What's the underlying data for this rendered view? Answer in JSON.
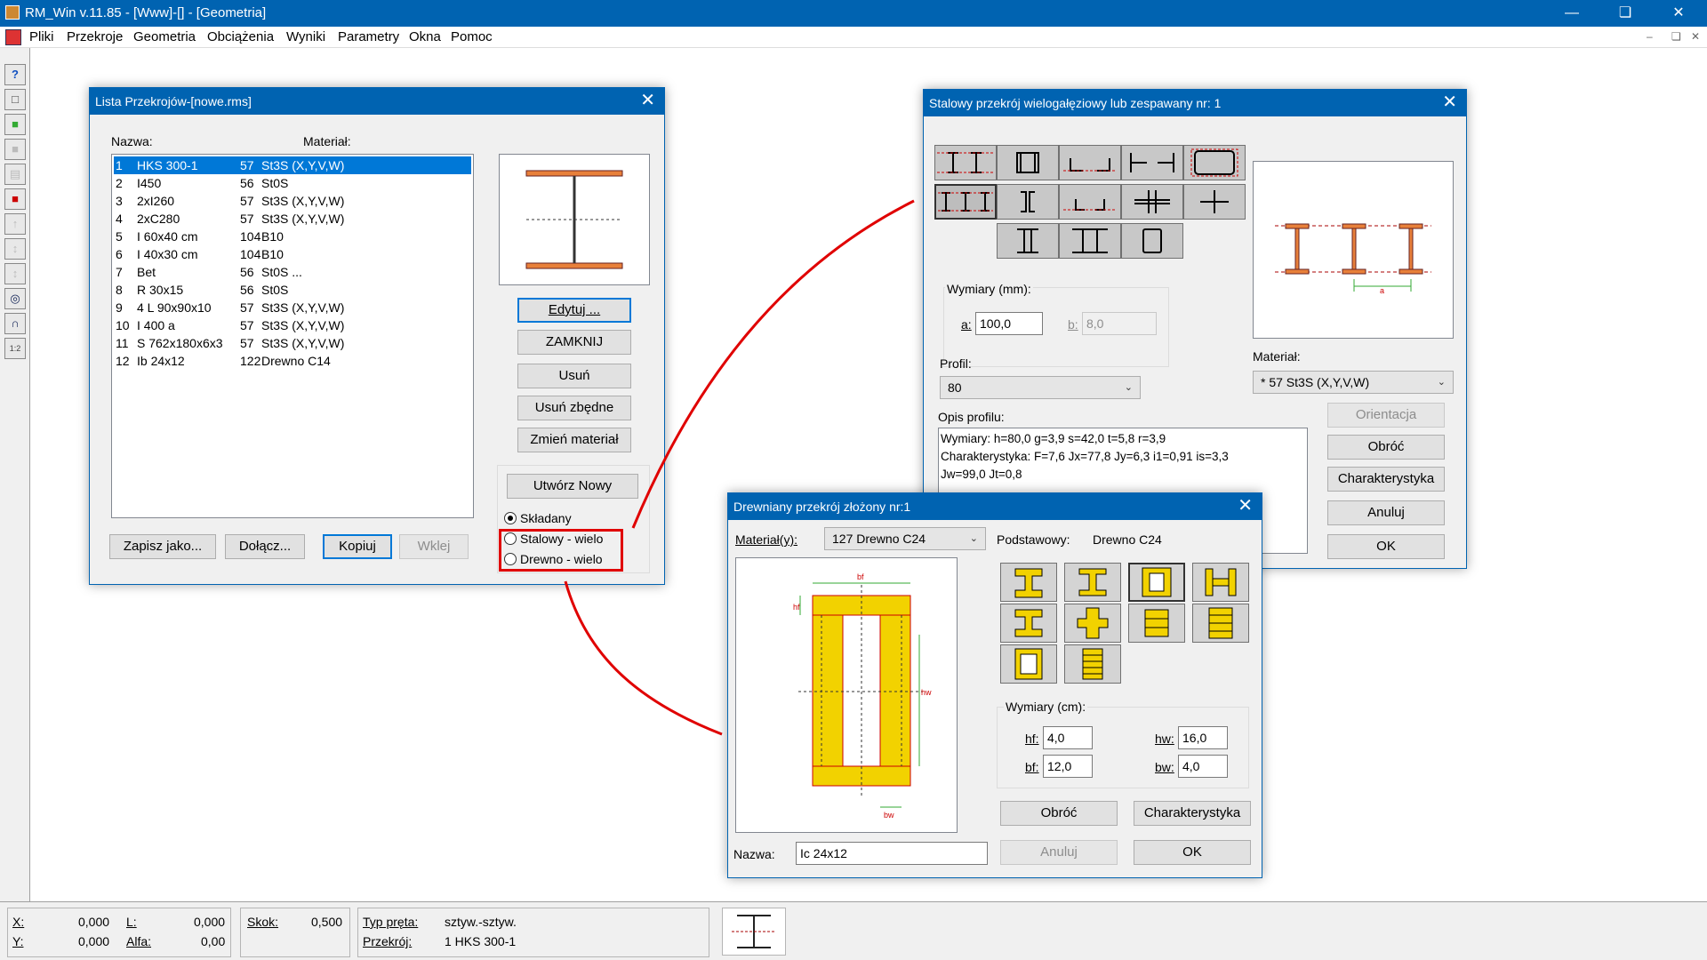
{
  "app": {
    "title": "RM_Win v.11.85 - [Www]-[] - [Geometria]"
  },
  "menu": [
    "Pliki",
    "Przekroje",
    "Geometria",
    "Obciążenia",
    "Wyniki",
    "Parametry",
    "Okna",
    "Pomoc"
  ],
  "lista": {
    "title": "Lista Przekrojów-[nowe.rms]",
    "col_name": "Nazwa:",
    "col_mat": "Materiał:",
    "rows": [
      {
        "n": "1",
        "name": "HKS 300-1",
        "code": "57",
        "mat": "St3S (X,Y,V,W)"
      },
      {
        "n": "2",
        "name": "I450",
        "code": "56",
        "mat": "St0S"
      },
      {
        "n": "3",
        "name": "2xI260",
        "code": "57",
        "mat": "St3S (X,Y,V,W)"
      },
      {
        "n": "4",
        "name": "2xC280",
        "code": "57",
        "mat": "St3S (X,Y,V,W)"
      },
      {
        "n": "5",
        "name": "I 60x40 cm",
        "code": "104",
        "mat": "B10"
      },
      {
        "n": "6",
        "name": "I 40x30 cm",
        "code": "104",
        "mat": "B10"
      },
      {
        "n": "7",
        "name": "Bet",
        "code": "56",
        "mat": "St0S ..."
      },
      {
        "n": "8",
        "name": "R 30x15",
        "code": "56",
        "mat": "St0S"
      },
      {
        "n": "9",
        "name": "4 L 90x90x10",
        "code": "57",
        "mat": "St3S (X,Y,V,W)"
      },
      {
        "n": "10",
        "name": "I 400 a",
        "code": "57",
        "mat": "St3S (X,Y,V,W)"
      },
      {
        "n": "11",
        "name": "S 762x180x6x3",
        "code": "57",
        "mat": "St3S (X,Y,V,W)"
      },
      {
        "n": "12",
        "name": "Ib 24x12",
        "code": "122",
        "mat": "Drewno C14"
      }
    ],
    "btn_edytuj": "Edytuj ...",
    "btn_zamknij": "ZAMKNIJ",
    "btn_usun": "Usuń",
    "btn_usun_zbedne": "Usuń zbędne",
    "btn_zmien": "Zmień materiał",
    "btn_utworz": "Utwórz Nowy",
    "radio_skladany": "Składany",
    "radio_stalowy": "Stalowy - wielo",
    "radio_drewno": "Drewno - wielo",
    "btn_zapisz": "Zapisz jako...",
    "btn_dolacz": "Dołącz...",
    "btn_kopiuj": "Kopiuj",
    "btn_wklej": "Wklej"
  },
  "stalowy": {
    "title": "Stalowy przekrój wielogałęziowy lub zespawany nr: 1",
    "wymiary": "Wymiary (mm):",
    "a_lbl": "a:",
    "a_val": "100,0",
    "b_lbl": "b:",
    "b_val": "8,0",
    "profil_lbl": "Profil:",
    "profil_val": "80",
    "material_lbl": "Materiał:",
    "material_val": "* 57  St3S (X,Y,V,W)",
    "opis_lbl": "Opis profilu:",
    "opis1": "Wymiary: h=80,0  g=3,9  s=42,0  t=5,8  r=3,9",
    "opis2": "Charakterystyka:     F=7,6  Jx=77,8  Jy=6,3  i1=0,91  is=3,3",
    "opis3": "Jw=99,0  Jt=0,8",
    "btn_orient": "Orientacja",
    "btn_obroc": "Obróć",
    "btn_char": "Charakterystyka",
    "btn_anuluj": "Anuluj",
    "btn_ok": "OK",
    "dim_a": "a"
  },
  "drewno": {
    "title": "Drewniany przekrój złożony nr:1",
    "material_lbl": "Materiał(y):",
    "material_val": "127  Drewno C24",
    "podst_lbl": "Podstawowy:",
    "podst_val": "Drewno C24",
    "wymiary": "Wymiary (cm):",
    "hf_lbl": "hf:",
    "hf_val": "4,0",
    "hw_lbl": "hw:",
    "hw_val": "16,0",
    "bf_lbl": "bf:",
    "bf_val": "12,0",
    "bw_lbl": "bw:",
    "bw_val": "4,0",
    "btn_obroc": "Obróć",
    "btn_char": "Charakterystyka",
    "btn_anuluj": "Anuluj",
    "btn_ok": "OK",
    "nazwa_lbl": "Nazwa:",
    "nazwa_val": "Ic 24x12",
    "dim_bf": "bf",
    "dim_hf": "hf",
    "dim_hw": "hw",
    "dim_bw": "bw"
  },
  "status": {
    "x_lbl": "X:",
    "x_val": "0,000",
    "y_lbl": "Y:",
    "y_val": "0,000",
    "l_lbl": "L:",
    "l_val": "0,000",
    "alfa_lbl": "Alfa:",
    "alfa_val": "0,00",
    "skok_lbl": "Skok:",
    "skok_val": "0,500",
    "typ_lbl": "Typ pręta:",
    "typ_val": "sztyw.-sztyw.",
    "przekroj_lbl": "Przekrój:",
    "przekroj_val": "1   HKS 300-1"
  },
  "colors": {
    "titlebar": "#0063b1",
    "select": "#0078d7",
    "highlight": "#e00000",
    "wood": "#f2d200",
    "steel": "#e8803a"
  }
}
